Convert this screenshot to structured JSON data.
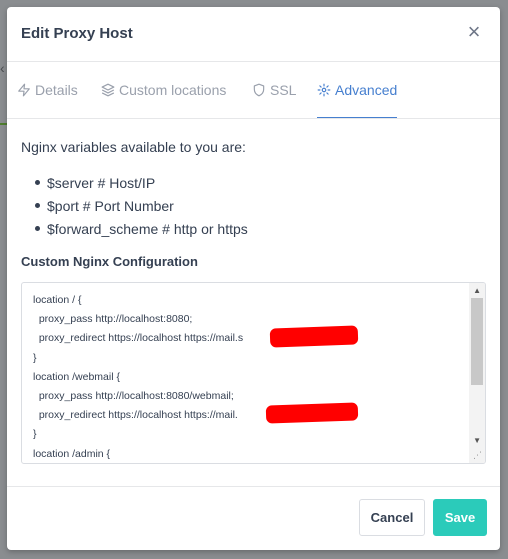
{
  "modal": {
    "title": "Edit Proxy Host",
    "close_icon": "×"
  },
  "tabs": [
    {
      "label": "Details",
      "icon": "bolt-icon",
      "active": false
    },
    {
      "label": "Custom locations",
      "icon": "layers-icon",
      "active": false
    },
    {
      "label": "SSL",
      "icon": "shield-icon",
      "active": false
    },
    {
      "label": "Advanced",
      "icon": "gear-icon",
      "active": true
    }
  ],
  "advanced": {
    "intro": "Nginx variables available to you are:",
    "variables": [
      "$server # Host/IP",
      "$port # Port Number",
      "$forward_scheme # http or https"
    ],
    "config_label": "Custom Nginx Configuration",
    "config_lines": [
      "location / {",
      "  proxy_pass http://localhost:8080;",
      "  proxy_redirect https://localhost https://mail.s",
      "}",
      "location /webmail {",
      "  proxy_pass http://localhost:8080/webmail;",
      "  proxy_redirect https://localhost https://mail.",
      "}",
      "location /admin {"
    ]
  },
  "footer": {
    "cancel_label": "Cancel",
    "save_label": "Save"
  },
  "colors": {
    "accent": "#467fcf",
    "save": "#2bcbba",
    "redaction": "#ff0000"
  }
}
